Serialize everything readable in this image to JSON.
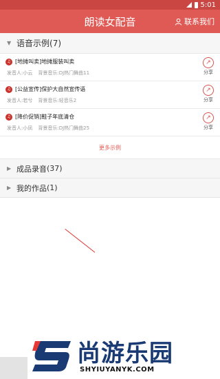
{
  "status_bar": {
    "time": "5:01"
  },
  "header": {
    "title": "朗读女配音",
    "contact_label": "联系我们"
  },
  "sections": {
    "samples": {
      "label": "语音示例",
      "count": "(7)",
      "items": [
        {
          "title": "[地摊叫卖]地摊服装叫卖",
          "speaker": "发音人:小云",
          "music": "背景音乐:DJ热门舞曲11",
          "share": "分享"
        },
        {
          "title": "[公益宣传]保护大自然宣传语",
          "speaker": "发音人:若兮",
          "music": "背景音乐:轻音乐2",
          "share": "分享"
        },
        {
          "title": "[降价促销]鞋子年底清仓",
          "speaker": "发音人:小凤",
          "music": "背景音乐:DJ热门舞曲25",
          "share": "分享"
        }
      ],
      "more_label": "更多示例"
    },
    "recordings": {
      "label": "成品录音",
      "count": "(37)"
    },
    "works": {
      "label": "我的作品",
      "count": "(1)"
    }
  },
  "watermark": {
    "brand_cn": "尚游乐园",
    "brand_url": "SHYIUYANYK.COM"
  },
  "colors": {
    "header": "#e05a55",
    "accent": "#d9534f",
    "brand_blue": "#1a3a73"
  }
}
